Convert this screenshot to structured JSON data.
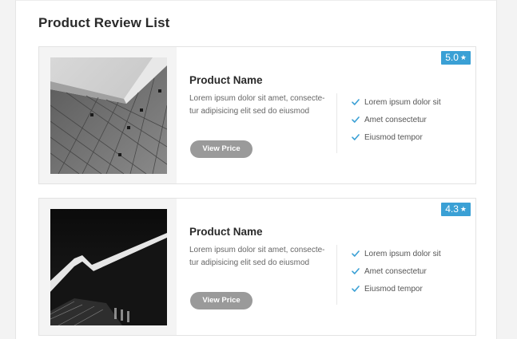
{
  "page": {
    "title": "Product Review List"
  },
  "colors": {
    "accent": "#3aa0d5",
    "button": "#9a9a9a"
  },
  "icons": {
    "rating": "star-icon",
    "feature": "check-icon"
  },
  "products": [
    {
      "rating": "5.0",
      "name": "Product Name",
      "description": "Lorem ipsum dolor sit amet, consecte-tur adipisicing elit sed do eiusmod",
      "button_label": "View Price",
      "features": [
        "Lorem ipsum dolor sit",
        "Amet consectetur",
        "Eiusmod tempor"
      ]
    },
    {
      "rating": "4.3",
      "name": "Product Name",
      "description": "Lorem ipsum dolor sit amet, consecte-tur adipisicing elit sed do eiusmod",
      "button_label": "View Price",
      "features": [
        "Lorem ipsum dolor sit",
        "Amet consectetur",
        "Eiusmod tempor"
      ]
    }
  ]
}
